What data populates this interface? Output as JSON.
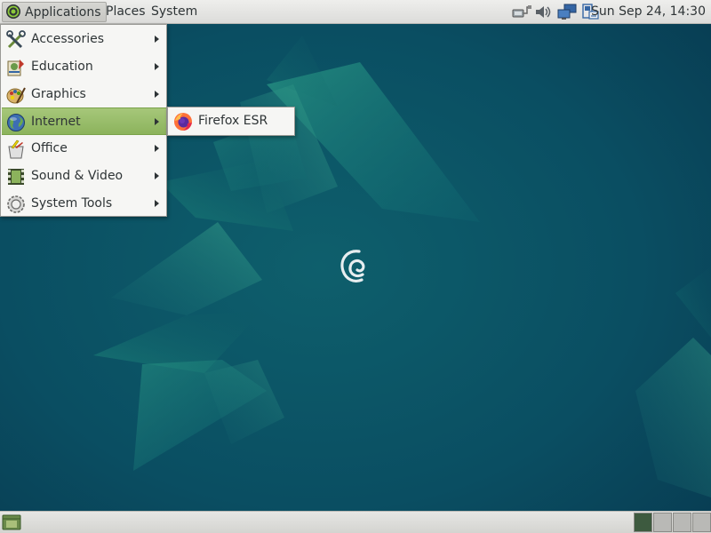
{
  "top_panel": {
    "menus": {
      "applications": "Applications",
      "places": "Places",
      "system": "System"
    },
    "tray_icons": [
      "network-wired-icon",
      "volume-icon",
      "network-workgroup-icon",
      "update-manager-icon"
    ],
    "clock": "Sun Sep 24, 14:30"
  },
  "applications_menu": {
    "items": [
      {
        "label": "Accessories",
        "icon": "accessories-icon",
        "has_submenu": true
      },
      {
        "label": "Education",
        "icon": "education-icon",
        "has_submenu": true
      },
      {
        "label": "Graphics",
        "icon": "graphics-icon",
        "has_submenu": true
      },
      {
        "label": "Internet",
        "icon": "internet-globe-icon",
        "has_submenu": true,
        "active": true
      },
      {
        "label": "Office",
        "icon": "office-icon",
        "has_submenu": true
      },
      {
        "label": "Sound & Video",
        "icon": "sound-video-icon",
        "has_submenu": true
      },
      {
        "label": "System Tools",
        "icon": "system-tools-icon",
        "has_submenu": true
      }
    ],
    "highlight_color": "#8cb35c"
  },
  "internet_submenu": {
    "items": [
      {
        "label": "Firefox ESR",
        "icon": "firefox-icon"
      }
    ]
  },
  "bottom_panel": {
    "show_desktop_icon": "show-desktop-icon",
    "workspaces": [
      {
        "active": true
      },
      {
        "active": false
      },
      {
        "active": false
      },
      {
        "active": false
      }
    ]
  },
  "colors": {
    "desktop_background": "#0a4a5e",
    "accent_green": "#8cb35c",
    "panel_bg": "#e6e6e4"
  }
}
